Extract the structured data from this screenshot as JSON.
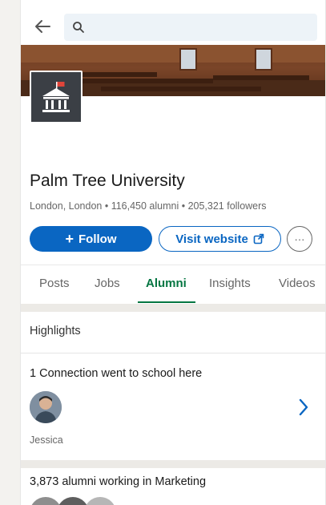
{
  "search": {
    "placeholder": ""
  },
  "school": {
    "name": "Palm Tree University",
    "location": "London, London",
    "alumni": "116,450 alumni",
    "followers": "205,321 followers",
    "subtitle": "London, London • 116,450 alumni • 205,321 followers"
  },
  "actions": {
    "follow_label": "Follow",
    "follow_prefix": "+",
    "visit_label": "Visit website",
    "more_label": "···"
  },
  "tabs": [
    {
      "label": "Posts"
    },
    {
      "label": "Jobs"
    },
    {
      "label": "Alumni",
      "active": true
    },
    {
      "label": "Insights"
    },
    {
      "label": "Videos"
    }
  ],
  "highlights": {
    "title": "Highlights",
    "connection_text": "1 Connection went to school here",
    "connection_name": "Jessica",
    "alumni_marketing": "3,873 alumni working in Marketing"
  },
  "colors": {
    "brand_blue": "#0a66c2",
    "active_tab_green": "#057642"
  },
  "icons": {
    "back": "arrow-left-icon",
    "search": "search-icon",
    "external": "external-link-icon",
    "more": "ellipsis-icon",
    "chevron": "chevron-right-icon",
    "logo": "university-building-icon"
  }
}
